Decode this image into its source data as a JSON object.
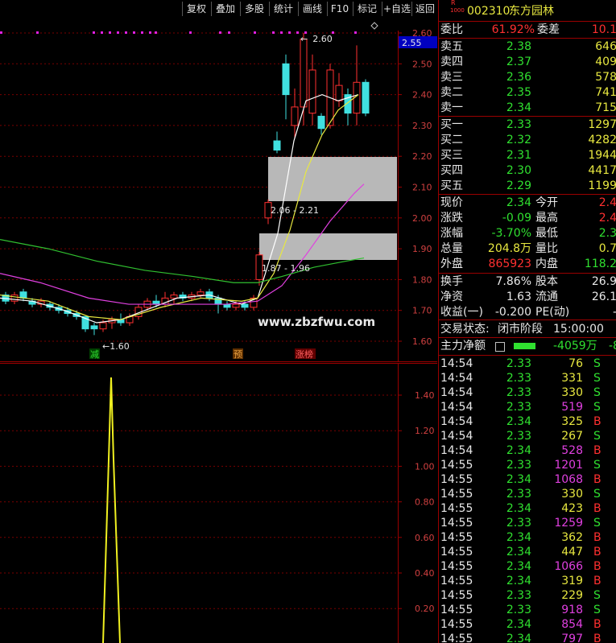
{
  "toolbar": {
    "buttons": [
      "复权",
      "叠加",
      "多股",
      "统计",
      "画线",
      "F10",
      "标记",
      "+自选",
      "返回"
    ]
  },
  "stock": {
    "badge_top": "R",
    "badge_bottom": "1000",
    "code": "002310",
    "name": "东方园林"
  },
  "main_chart": {
    "y_ticks": [
      "2.60",
      "2.50",
      "2.40",
      "2.30",
      "2.20",
      "2.10",
      "2.00",
      "1.90",
      "1.80",
      "1.70",
      "1.60"
    ],
    "current_price_tag": "2.55",
    "high_label": "2.60",
    "low_label": "1.60",
    "zone_upper_label": "2.06 - 2.21",
    "zone_lower_label": "1.87 - 1.96",
    "markers": [
      "减",
      "预",
      "涨榜"
    ],
    "watermark": "www.zbzfwu.com",
    "colors": {
      "up": "#ff3030",
      "down": "#40e0e0",
      "ma5": "#ffffff",
      "ma10": "#e8e840",
      "ma20": "#e040e0",
      "ma60": "#30c030"
    }
  },
  "indicator_chart": {
    "y_ticks": [
      "1.40",
      "1.20",
      "1.00",
      "0.80",
      "0.60",
      "0.40",
      "0.20"
    ]
  },
  "quote": {
    "ratio_label": "委比",
    "ratio_value": "61.92%",
    "diff_label": "委差",
    "diff_value": "10.1",
    "asks": [
      {
        "label": "卖五",
        "price": "2.38",
        "vol": "646"
      },
      {
        "label": "卖四",
        "price": "2.37",
        "vol": "409"
      },
      {
        "label": "卖三",
        "price": "2.36",
        "vol": "578"
      },
      {
        "label": "卖二",
        "price": "2.35",
        "vol": "741"
      },
      {
        "label": "卖一",
        "price": "2.34",
        "vol": "715"
      }
    ],
    "bids": [
      {
        "label": "买一",
        "price": "2.33",
        "vol": "1297"
      },
      {
        "label": "买二",
        "price": "2.32",
        "vol": "4282"
      },
      {
        "label": "买三",
        "price": "2.31",
        "vol": "1944"
      },
      {
        "label": "买四",
        "price": "2.30",
        "vol": "4417"
      },
      {
        "label": "买五",
        "price": "2.29",
        "vol": "1199"
      }
    ],
    "stats": [
      {
        "l1": "现价",
        "v1": "2.34",
        "l2": "今开",
        "v2": "2.4"
      },
      {
        "l1": "涨跌",
        "v1": "-0.09",
        "l2": "最高",
        "v2": "2.4"
      },
      {
        "l1": "涨幅",
        "v1": "-3.70%",
        "l2": "最低",
        "v2": "2.3"
      },
      {
        "l1": "总量",
        "v1": "204.8万",
        "l2": "量比",
        "v2": "0.7"
      },
      {
        "l1": "外盘",
        "v1": "865923",
        "l2": "内盘",
        "v2": "118.2"
      }
    ],
    "stats2": [
      {
        "l1": "换手",
        "v1": "7.86%",
        "l2": "股本",
        "v2": "26.9"
      },
      {
        "l1": "净资",
        "v1": "1.63",
        "l2": "流通",
        "v2": "26.1"
      },
      {
        "l1": "收益(一)",
        "v1": "-0.200",
        "l2": "PE(动)",
        "v2": "-"
      }
    ],
    "status_label": "交易状态:",
    "status_value": "闭市阶段",
    "status_time": "15:00:00",
    "mainflow_label": "主力净额",
    "mainflow_value": "-4059万",
    "mainflow_extra": "-8"
  },
  "ticks": [
    {
      "t": "14:54",
      "p": "2.33",
      "v": "76",
      "s": "S"
    },
    {
      "t": "14:54",
      "p": "2.33",
      "v": "331",
      "s": "S"
    },
    {
      "t": "14:54",
      "p": "2.33",
      "v": "330",
      "s": "S"
    },
    {
      "t": "14:54",
      "p": "2.33",
      "v": "519",
      "s": "S"
    },
    {
      "t": "14:54",
      "p": "2.34",
      "v": "325",
      "s": "B"
    },
    {
      "t": "14:54",
      "p": "2.33",
      "v": "267",
      "s": "S"
    },
    {
      "t": "14:54",
      "p": "2.34",
      "v": "528",
      "s": "B"
    },
    {
      "t": "14:55",
      "p": "2.33",
      "v": "1201",
      "s": "S"
    },
    {
      "t": "14:55",
      "p": "2.34",
      "v": "1068",
      "s": "B"
    },
    {
      "t": "14:55",
      "p": "2.33",
      "v": "330",
      "s": "S"
    },
    {
      "t": "14:55",
      "p": "2.34",
      "v": "423",
      "s": "B"
    },
    {
      "t": "14:55",
      "p": "2.33",
      "v": "1259",
      "s": "S"
    },
    {
      "t": "14:55",
      "p": "2.34",
      "v": "362",
      "s": "B"
    },
    {
      "t": "14:55",
      "p": "2.34",
      "v": "447",
      "s": "B"
    },
    {
      "t": "14:55",
      "p": "2.34",
      "v": "1066",
      "s": "B"
    },
    {
      "t": "14:55",
      "p": "2.34",
      "v": "319",
      "s": "B"
    },
    {
      "t": "14:55",
      "p": "2.33",
      "v": "229",
      "s": "S"
    },
    {
      "t": "14:55",
      "p": "2.33",
      "v": "918",
      "s": "S"
    },
    {
      "t": "14:55",
      "p": "2.34",
      "v": "854",
      "s": "B"
    },
    {
      "t": "14:55",
      "p": "2.34",
      "v": "797",
      "s": "B"
    }
  ]
}
